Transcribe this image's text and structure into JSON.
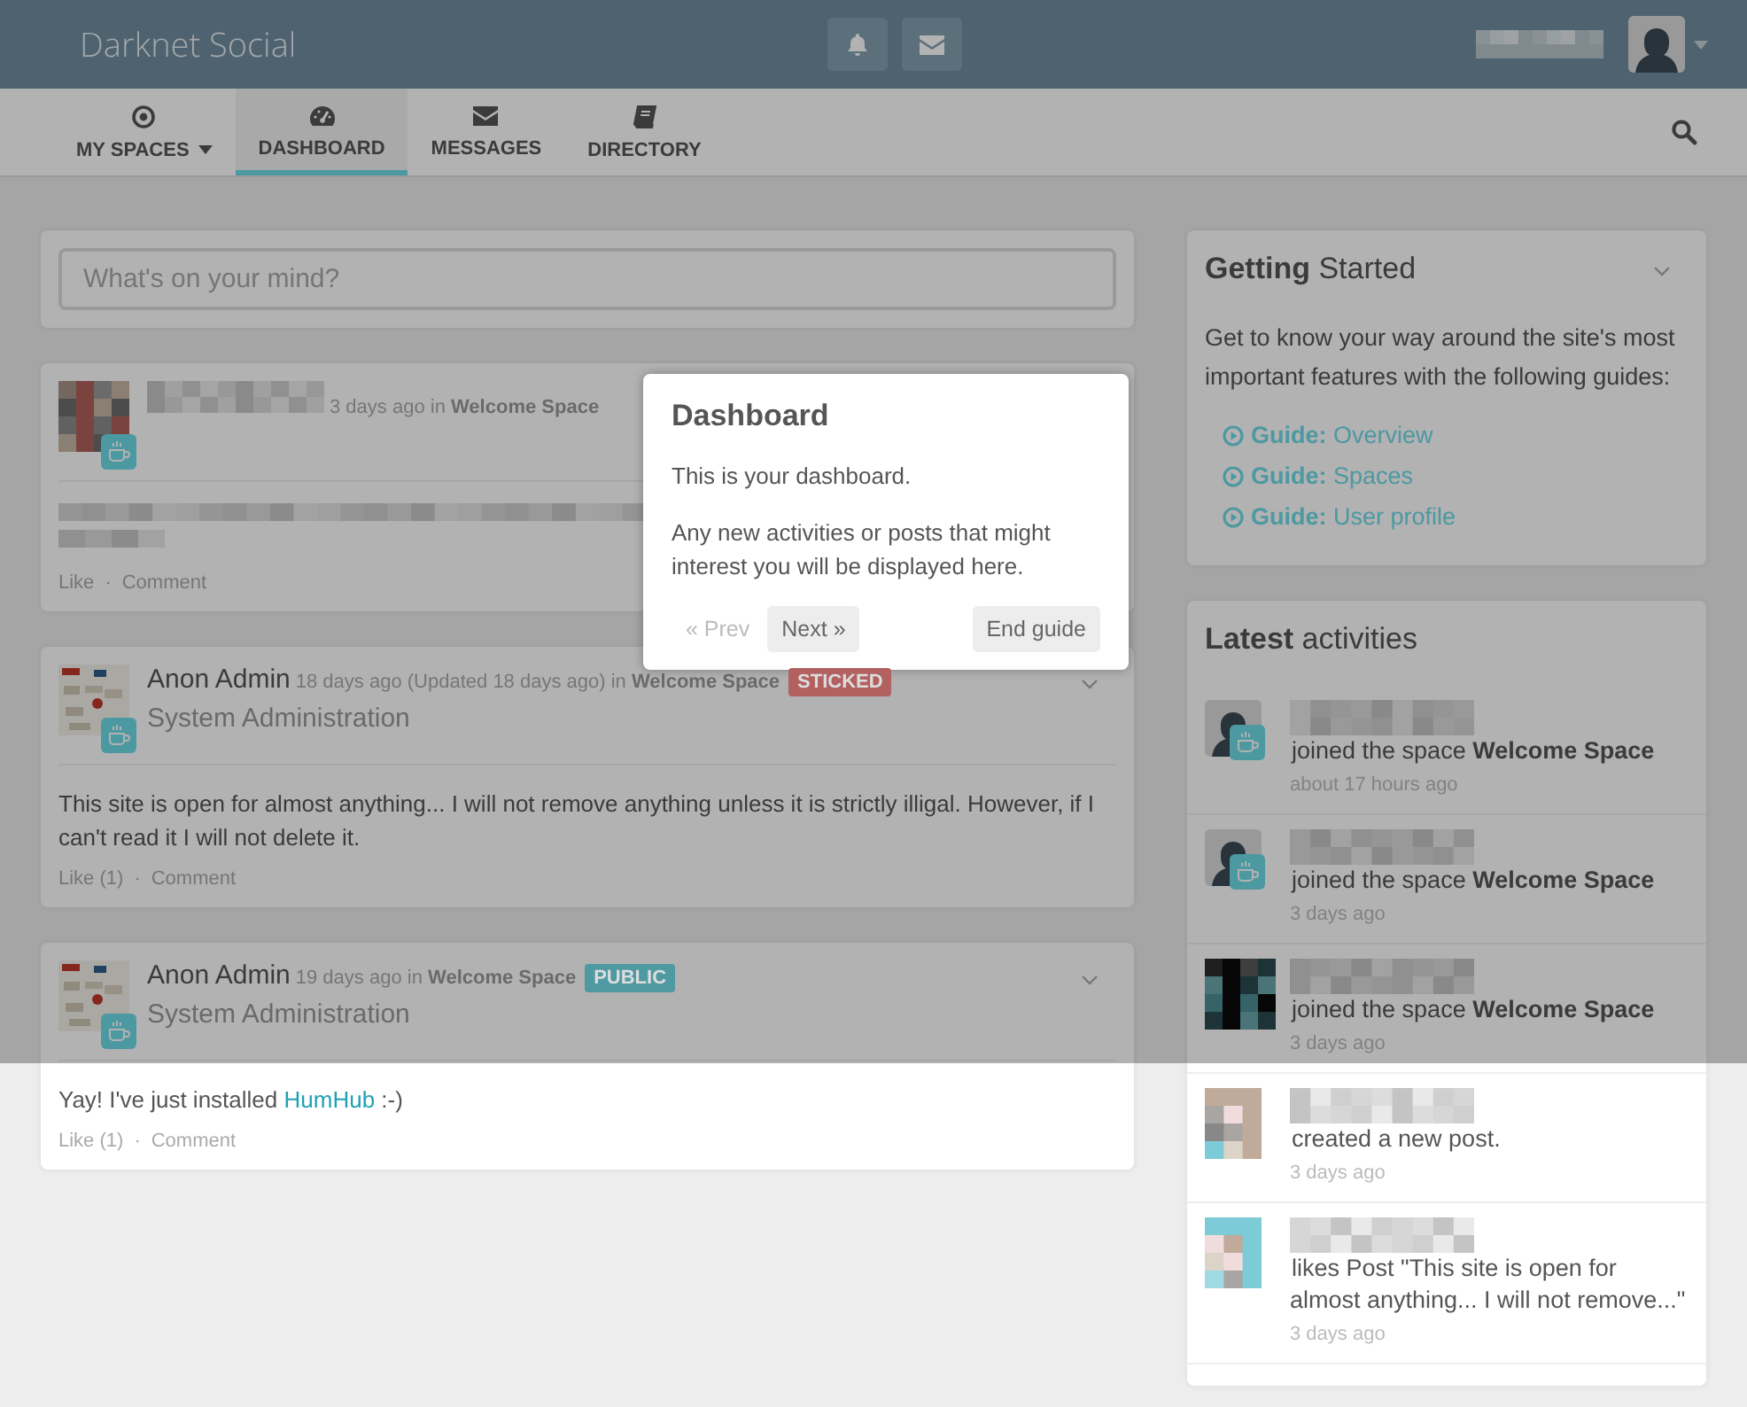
{
  "topbar": {
    "brand": "Darknet Social"
  },
  "nav": {
    "items": [
      {
        "label": "MY SPACES",
        "kind": "spaces",
        "has_menu": true,
        "selected": false
      },
      {
        "label": "DASHBOARD",
        "kind": "dashboard",
        "has_menu": false,
        "selected": true
      },
      {
        "label": "MESSAGES",
        "kind": "messages",
        "has_menu": false,
        "selected": false
      },
      {
        "label": "DIRECTORY",
        "kind": "directory",
        "has_menu": false,
        "selected": false
      }
    ]
  },
  "composer": {
    "placeholder": "What's on your mind?"
  },
  "posts": [
    {
      "kind": "blurred",
      "meta": "3 days ago in",
      "space": "Welcome Space",
      "toggle": false,
      "actions": [
        "Like",
        "Comment"
      ],
      "separator": "·"
    },
    {
      "kind": "named",
      "author": "Anon Admin",
      "meta": "18 days ago (Updated 18 days ago) in",
      "space": "Welcome Space",
      "badge": {
        "label": "STICKED",
        "color": "#b26060"
      },
      "subtitle": "System Administration",
      "toggle": true,
      "body": [
        {
          "kind": "text",
          "text": "This site is open for almost anything... I will not remove anything unless it is strictly illigal. However, if I can't read it I will not delete it."
        }
      ],
      "actions": [
        "Like (1)",
        "Comment"
      ],
      "separator": "·"
    },
    {
      "kind": "named",
      "author": "Anon Admin",
      "meta": "19 days ago in",
      "space": "Welcome Space",
      "badge": {
        "label": "PUBLIC",
        "color": "#4e99a2"
      },
      "subtitle": "System Administration",
      "toggle": true,
      "body": [
        {
          "kind": "text",
          "text": "Yay! I've just installed "
        },
        {
          "kind": "link",
          "text": "HumHub"
        },
        {
          "kind": "text",
          "text": " :-)"
        }
      ],
      "actions": [
        "Like (1)",
        "Comment"
      ],
      "separator": "·"
    }
  ],
  "getting_started": {
    "title_bold": "Getting",
    "title_rest": "Started",
    "intro": "Get to know your way around the site's most important features with the following guides:",
    "guides": [
      {
        "prefix": "Guide:",
        "label": "Overview"
      },
      {
        "prefix": "Guide:",
        "label": "Spaces"
      },
      {
        "prefix": "Guide:",
        "label": "User profile"
      }
    ]
  },
  "activities": {
    "title_bold": "Latest",
    "title_rest": "activities",
    "items": [
      {
        "kind": "silhouette",
        "text": "joined the space **Welcome Space**",
        "time": "about 17 hours ago"
      },
      {
        "kind": "silhouette",
        "text": "joined the space **Welcome Space**",
        "time": "3 days ago"
      },
      {
        "kind": "dark-mosaic",
        "text": "joined the space **Welcome Space**",
        "time": "3 days ago"
      },
      {
        "kind": "light-mosaic",
        "text": "created a new post.",
        "time": "3 days ago"
      },
      {
        "kind": "light-mosaic",
        "text": "likes Post \"This site is open for almost anything... I will not remove...\"",
        "time": "3 days ago"
      }
    ]
  },
  "tour": {
    "title": "Dashboard",
    "paragraphs": [
      "This is your dashboard.",
      "Any new activities or posts that might interest you will be displayed here."
    ],
    "prev": {
      "label": "« Prev",
      "disabled": true
    },
    "next": "Next »",
    "end": "End guide"
  }
}
